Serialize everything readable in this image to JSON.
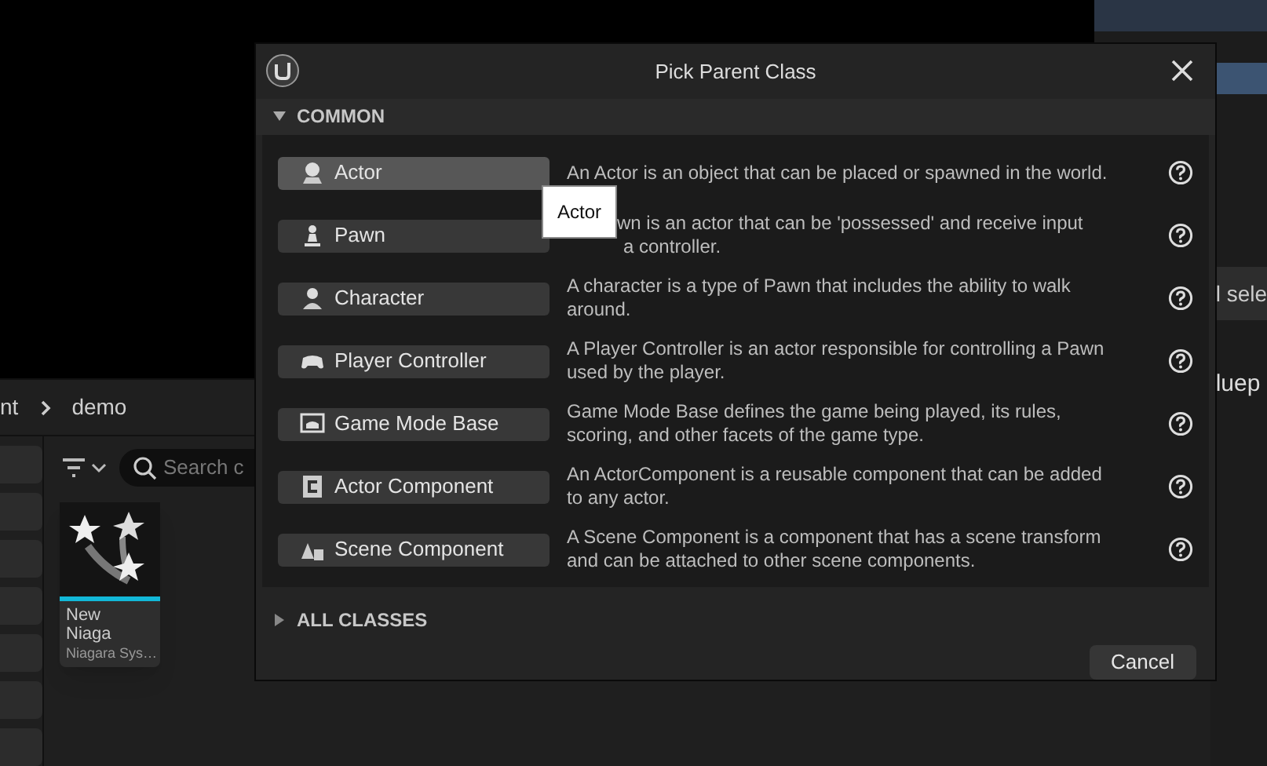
{
  "background": {
    "breadcrumb": [
      "nt",
      "demo"
    ],
    "search": {
      "placeholder": "Search c"
    },
    "asset": {
      "name_lines": [
        "New",
        "Niaga"
      ],
      "type": "Niagara Sys…"
    },
    "side_texts": [
      "l sele",
      "luep"
    ]
  },
  "dialog": {
    "title": "Pick Parent Class",
    "sections": [
      {
        "label": "COMMON",
        "expanded": true
      },
      {
        "label": "ALL CLASSES",
        "expanded": false
      }
    ],
    "classes": [
      {
        "kind": "actor",
        "label": "Actor",
        "hovered": true,
        "occluded": false,
        "description": [
          "An Actor is an object that can be placed or spawned in the world."
        ]
      },
      {
        "kind": "pawn",
        "label": "Pawn",
        "hovered": false,
        "occluded": true,
        "description": [
          "wn is an actor that can be 'possessed' and receive input",
          "a controller."
        ]
      },
      {
        "kind": "character",
        "label": "Character",
        "hovered": false,
        "occluded": false,
        "description": [
          "A character is a type of Pawn that includes the ability to walk",
          "around."
        ]
      },
      {
        "kind": "controller",
        "label": "Player Controller",
        "hovered": false,
        "occluded": false,
        "description": [
          "A Player Controller is an actor responsible for controlling a Pawn",
          "used by the player."
        ]
      },
      {
        "kind": "gamemode",
        "label": "Game Mode Base",
        "hovered": false,
        "occluded": false,
        "description": [
          "Game Mode Base defines the game being played, its rules,",
          "scoring, and other facets of the game type."
        ]
      },
      {
        "kind": "component",
        "label": "Actor Component",
        "hovered": false,
        "occluded": false,
        "description": [
          "An ActorComponent is a reusable component that can be added",
          "to any actor."
        ]
      },
      {
        "kind": "scene",
        "label": "Scene Component",
        "hovered": false,
        "occluded": false,
        "description": [
          "A Scene Component is a component that has a scene transform",
          "and can be attached to other scene components."
        ]
      }
    ],
    "tooltip": "Actor",
    "cancel": "Cancel"
  }
}
